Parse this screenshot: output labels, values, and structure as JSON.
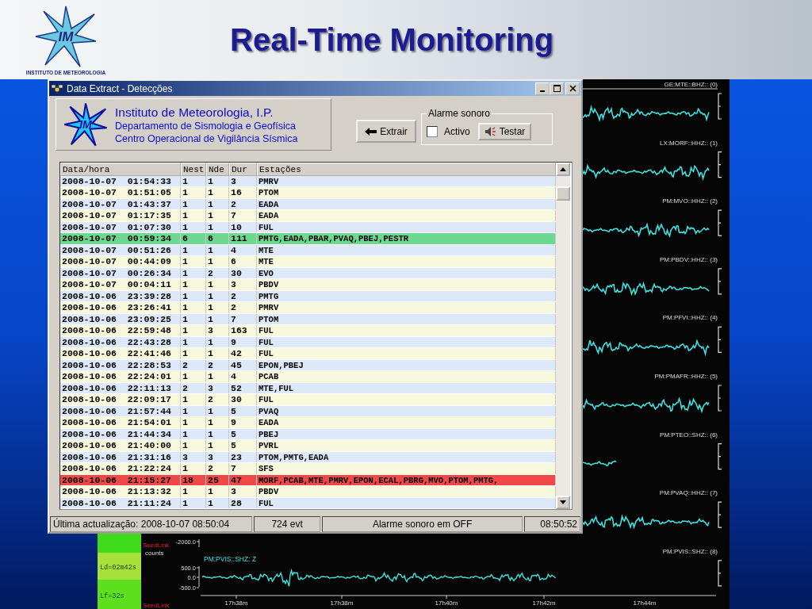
{
  "slide": {
    "title": "Real-Time Monitoring",
    "logo": {
      "monogram": "IM",
      "caption": "INSTITUTO DE METEOROLOGIA"
    }
  },
  "seismic_display": {
    "channels": [
      {
        "label": "GE:MTE::BHZ:: (0)",
        "kind": "trace"
      },
      {
        "label": "LX:MORF::HHZ:: (1)",
        "kind": "trace"
      },
      {
        "label": "PM:MVO::HHZ:: (2)",
        "kind": "trace"
      },
      {
        "label": "PM:PBDV::HHZ:: (3)",
        "kind": "trace"
      },
      {
        "label": "PM:PFVI::HHZ:: (4)",
        "kind": "trace"
      },
      {
        "label": "PM:PMAFR::HHZ:: (5)",
        "kind": "trace"
      },
      {
        "label": "PM:PTEO::SHZ:: (6)",
        "kind": "partial-trace"
      },
      {
        "label": "PM:PVAQ::HHZ:: (7)",
        "kind": "trace"
      },
      {
        "label": "PM:PVIS::SHZ:: (8)",
        "kind": "empty"
      }
    ],
    "time_label_right": "17h44m",
    "detail": {
      "status_boxes": [
        {
          "color": "#3fdc1e"
        },
        {
          "text": "Ld=02m42s",
          "color": "#a8e03a"
        },
        {
          "text": "Lf=32s",
          "color": "#5ce01e"
        }
      ],
      "source_top": "SeedLink",
      "source_bottom": "SeedLink",
      "units": "counts",
      "trace_label": "PM:PVIS::SHZ: Z",
      "y_labels": [
        "-2000.0",
        "500.0",
        "0.0",
        "-500.0"
      ],
      "time_labels": [
        "17h38m",
        "17h38m",
        "17h40m",
        "17h42m"
      ]
    }
  },
  "window": {
    "title": "Data Extract - Detecções",
    "header": {
      "lines": [
        "Instituto de Meteorologia, I.P.",
        "Departamento de Sismologia e Geofísica",
        "Centro Operacional de Vigilância Sísmica"
      ],
      "monogram": "IM"
    },
    "extract_button": "Extrair",
    "alarm_group": {
      "title": "Alarme sonoro",
      "checkbox": {
        "label": "Activo",
        "checked": false
      },
      "test_button": "Testar"
    },
    "table": {
      "columns": [
        "Data/hora",
        "Nest",
        "Nde",
        "Dur",
        "Estações"
      ],
      "rows": [
        {
          "cells": [
            "2008-10-07  01:54:33",
            "1",
            "1",
            "3",
            "PMRV"
          ]
        },
        {
          "cells": [
            "2008-10-07  01:51:05",
            "1",
            "1",
            "16",
            "PTOM"
          ]
        },
        {
          "cells": [
            "2008-10-07  01:43:37",
            "1",
            "1",
            "2",
            "EADA"
          ]
        },
        {
          "cells": [
            "2008-10-07  01:17:35",
            "1",
            "1",
            "7",
            "EADA"
          ]
        },
        {
          "cells": [
            "2008-10-07  01:07:30",
            "1",
            "1",
            "10",
            "FUL"
          ]
        },
        {
          "cells": [
            "2008-10-07  00:59:34",
            "6",
            "6",
            "111",
            "PMTG,EADA,PBAR,PVAQ,PBEJ,PESTR"
          ],
          "color": "#6fd890"
        },
        {
          "cells": [
            "2008-10-07  00:51:26",
            "1",
            "1",
            "4",
            "MTE"
          ]
        },
        {
          "cells": [
            "2008-10-07  00:44:09",
            "1",
            "1",
            "6",
            "MTE"
          ]
        },
        {
          "cells": [
            "2008-10-07  00:26:34",
            "1",
            "2",
            "30",
            "EVO"
          ]
        },
        {
          "cells": [
            "2008-10-07  00:04:11",
            "1",
            "1",
            "3",
            "PBDV"
          ]
        },
        {
          "cells": [
            "2008-10-06  23:39:28",
            "1",
            "1",
            "2",
            "PMTG"
          ]
        },
        {
          "cells": [
            "2008-10-06  23:26:41",
            "1",
            "1",
            "2",
            "PMRV"
          ]
        },
        {
          "cells": [
            "2008-10-06  23:09:25",
            "1",
            "1",
            "7",
            "PTOM"
          ]
        },
        {
          "cells": [
            "2008-10-06  22:59:48",
            "1",
            "3",
            "163",
            "FUL"
          ]
        },
        {
          "cells": [
            "2008-10-06  22:43:28",
            "1",
            "1",
            "9",
            "FUL"
          ]
        },
        {
          "cells": [
            "2008-10-06  22:41:46",
            "1",
            "1",
            "42",
            "FUL"
          ]
        },
        {
          "cells": [
            "2008-10-06  22:28:53",
            "2",
            "2",
            "45",
            "EPON,PBEJ"
          ]
        },
        {
          "cells": [
            "2008-10-06  22:24:01",
            "1",
            "1",
            "4",
            "PCAB"
          ]
        },
        {
          "cells": [
            "2008-10-06  22:11:13",
            "2",
            "3",
            "52",
            "MTE,FUL"
          ]
        },
        {
          "cells": [
            "2008-10-06  22:09:17",
            "1",
            "2",
            "30",
            "FUL"
          ]
        },
        {
          "cells": [
            "2008-10-06  21:57:44",
            "1",
            "1",
            "5",
            "PVAQ"
          ]
        },
        {
          "cells": [
            "2008-10-06  21:54:01",
            "1",
            "1",
            "9",
            "EADA"
          ]
        },
        {
          "cells": [
            "2008-10-06  21:44:34",
            "1",
            "1",
            "5",
            "PBEJ"
          ]
        },
        {
          "cells": [
            "2008-10-06  21:40:00",
            "1",
            "1",
            "5",
            "PVRL"
          ]
        },
        {
          "cells": [
            "2008-10-06  21:31:16",
            "3",
            "3",
            "23",
            "PTOM,PMTG,EADA"
          ]
        },
        {
          "cells": [
            "2008-10-06  21:22:24",
            "1",
            "2",
            "7",
            "SFS"
          ]
        },
        {
          "cells": [
            "2008-10-06  21:15:27",
            "18",
            "25",
            "47",
            "MORF,PCAB,MTE,PMRV,EPON,ECAL,PBRG,MVO,PTOM,PMTG,"
          ],
          "color": "#f04848"
        },
        {
          "cells": [
            "2008-10-06  21:13:32",
            "1",
            "1",
            "3",
            "PBDV"
          ]
        },
        {
          "cells": [
            "2008-10-06  21:11:24",
            "1",
            "1",
            "28",
            "FUL"
          ]
        }
      ]
    },
    "status_bar": [
      "Última actualização: 2008-10-07 08:50:04",
      "724 evt",
      "Alarme sonoro em OFF",
      "08:50:52"
    ]
  }
}
